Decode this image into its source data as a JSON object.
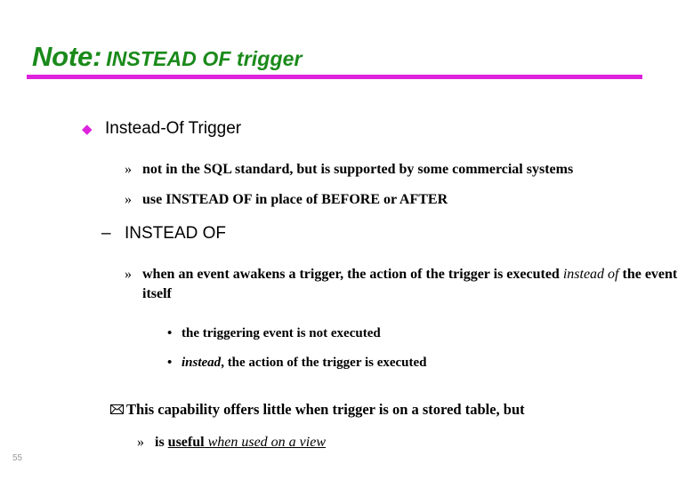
{
  "slide": {
    "title": {
      "lead": "Note:",
      "rest": "INSTEAD OF trigger",
      "color": "#1a8a1a",
      "rule_color": "#dd22dd"
    },
    "page_number": "55",
    "bullets": {
      "diamond_marker": "◆",
      "dash_marker": "–",
      "guillemet_marker": "»",
      "dot_marker": "•",
      "envelope_marker": "envelope-glyph"
    },
    "content": {
      "heading_instead_of_trigger": "Instead-Of Trigger",
      "item_not_in_sql_standard": "not in the SQL standard, but is supported by some commercial systems",
      "item_use_instead_of": "use INSTEAD OF in place of BEFORE or AFTER",
      "heading_instead_of": "INSTEAD OF",
      "item_when_event_part1": "when an event awakens a trigger, the action of the trigger is executed ",
      "item_when_event_italic": "instead of",
      "item_when_event_part2": " the event itself",
      "item_triggering_not_executed": "the triggering event is not executed",
      "item_instead_italic": "instead",
      "item_instead_rest": ", the action of the trigger is executed",
      "item_capability": "This capability offers little when trigger is on a stored table, but",
      "item_is": "is ",
      "item_useful": "useful",
      "item_when_used_on_view": " when used on a view"
    }
  }
}
